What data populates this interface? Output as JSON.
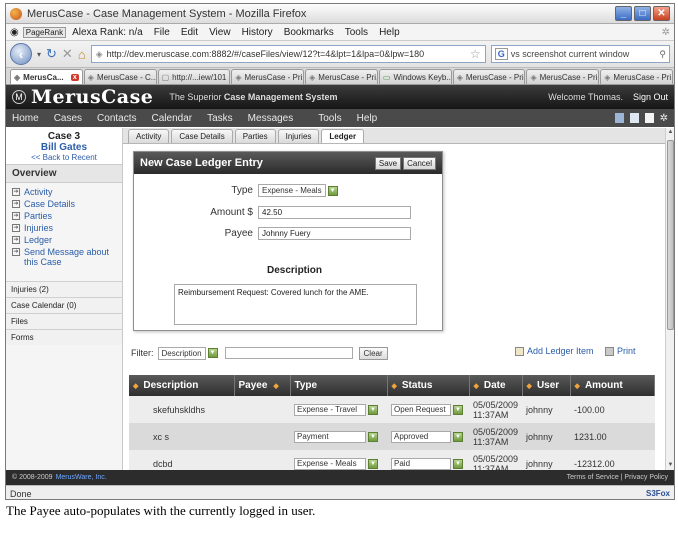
{
  "window": {
    "title": "MerusCase - Case Management System - Mozilla Firefox"
  },
  "menubar": {
    "pagerank": "PageRank",
    "alexa": "Alexa Rank: n/a",
    "items": [
      "File",
      "Edit",
      "View",
      "History",
      "Bookmarks",
      "Tools",
      "Help"
    ]
  },
  "navbar": {
    "url": "http://dev.meruscase.com:8882/#/caseFiles/view/12?t=4&lpt=1&lpa=0&lpw=180",
    "search_value": "vs screenshot current window"
  },
  "browser_tabs": [
    "MerusCa...",
    "MerusCase - C...",
    "http://...iew/101",
    "MerusCase - Pri...",
    "MerusCase - Pri...",
    "Windows Keyb...",
    "MerusCase - Pri...",
    "MerusCase - Pri...",
    "MerusCase - Pri..."
  ],
  "app": {
    "logo": "MerusCase",
    "tagline_plain": "The Superior",
    "tagline_bold": "Case Management System",
    "welcome": "Welcome Thomas.",
    "signout": "Sign Out",
    "nav": [
      "Home",
      "Cases",
      "Contacts",
      "Calendar",
      "Tasks",
      "Messages",
      "Tools",
      "Help"
    ]
  },
  "sidebar": {
    "case_number": "Case 3",
    "case_name": "Bill Gates",
    "back_link": "<< Back to Recent",
    "overview_title": "Overview",
    "overview_items": [
      "Activity",
      "Case Details",
      "Parties",
      "Injuries",
      "Ledger",
      "Send Message about this Case"
    ],
    "sections": [
      "Injuries (2)",
      "Case Calendar (0)",
      "Files",
      "Forms"
    ]
  },
  "case_tabs": [
    "Activity",
    "Case Details",
    "Parties",
    "Injuries",
    "Ledger"
  ],
  "dialog": {
    "title": "New Case Ledger Entry",
    "save": "Save",
    "cancel": "Cancel",
    "type_label": "Type",
    "type_value": "Expense - Meals",
    "amount_label": "Amount $",
    "amount_value": "42.50",
    "payee_label": "Payee",
    "payee_value": "Johnny Fuery",
    "description_label": "Description",
    "description_value": "Reimbursement Request: Covered lunch for the AME."
  },
  "filter": {
    "label": "Filter:",
    "field": "Description",
    "clear": "Clear",
    "add": "Add Ledger Item",
    "print": "Print"
  },
  "table": {
    "headers": [
      "Description",
      "Payee",
      "Type",
      "Status",
      "Date",
      "User",
      "Amount"
    ],
    "rows": [
      {
        "description": "skefuhskldhs",
        "payee": "",
        "type": "Expense - Travel",
        "status": "Open Request",
        "date": "05/05/2009",
        "time": "11:37AM",
        "user": "johnny",
        "amount": "-100.00"
      },
      {
        "description": "xc s",
        "payee": "",
        "type": "Payment",
        "status": "Approved",
        "date": "05/05/2009",
        "time": "11:37AM",
        "user": "johnny",
        "amount": "1231.00"
      },
      {
        "description": "dcbd",
        "payee": "",
        "type": "Expense - Meals",
        "status": "Paid",
        "date": "05/05/2009",
        "time": "11:37AM",
        "user": "johnny",
        "amount": "-12312.00"
      }
    ]
  },
  "footer": {
    "copyright": "© 2008-2009",
    "brand": "MerusWare, Inc.",
    "links": "Terms of Service | Privacy Policy"
  },
  "status": {
    "text": "Done",
    "s3": "S3Fox"
  },
  "caption": "The Payee auto-populates with the currently logged in user."
}
